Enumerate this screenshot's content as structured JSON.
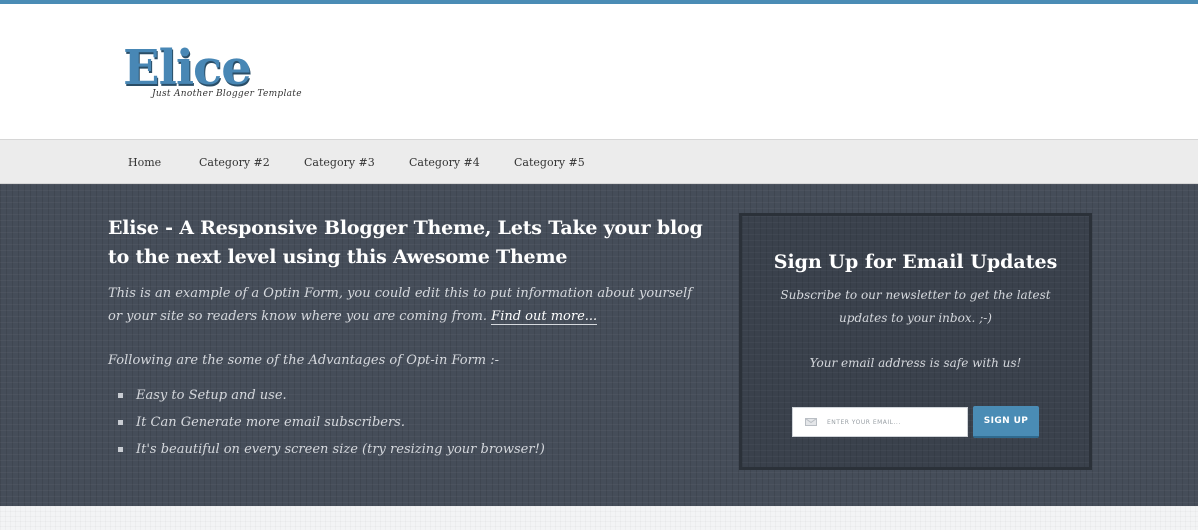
{
  "colors": {
    "accent": "#4a8cb5",
    "hero_bg": "#454d59",
    "optin_bg": "#3a414c",
    "nav_bg": "#ececec"
  },
  "header": {
    "logo_title": "Elice",
    "tagline": "Just Another Blogger Template"
  },
  "nav": {
    "items": [
      {
        "label": "Home"
      },
      {
        "label": "Category #2"
      },
      {
        "label": "Category #3"
      },
      {
        "label": "Category #4"
      },
      {
        "label": "Category #5"
      }
    ]
  },
  "hero": {
    "title": "Elise - A Responsive Blogger Theme, Lets Take your blog to the next level using this Awesome Theme",
    "intro": "This is an example of a Optin Form, you could edit this to put information about yourself or your site so readers know where you are coming from.",
    "link_text": "Find out more...",
    "advantages_heading": "Following are the some of the Advantages of Opt-in Form :-",
    "advantages": [
      "Easy to Setup and use.",
      "It Can Generate more email subscribers.",
      "It's beautiful on every screen size (try resizing your browser!)"
    ]
  },
  "optin": {
    "title": "Sign Up for Email Updates",
    "description": "Subscribe to our newsletter to get the latest updates to your inbox. ;-)",
    "safe_note": "Your email address is safe with us!",
    "email_placeholder": "Enter your email...",
    "email_value": "",
    "button_label": "SIGN UP",
    "mail_icon": "envelope-icon"
  }
}
